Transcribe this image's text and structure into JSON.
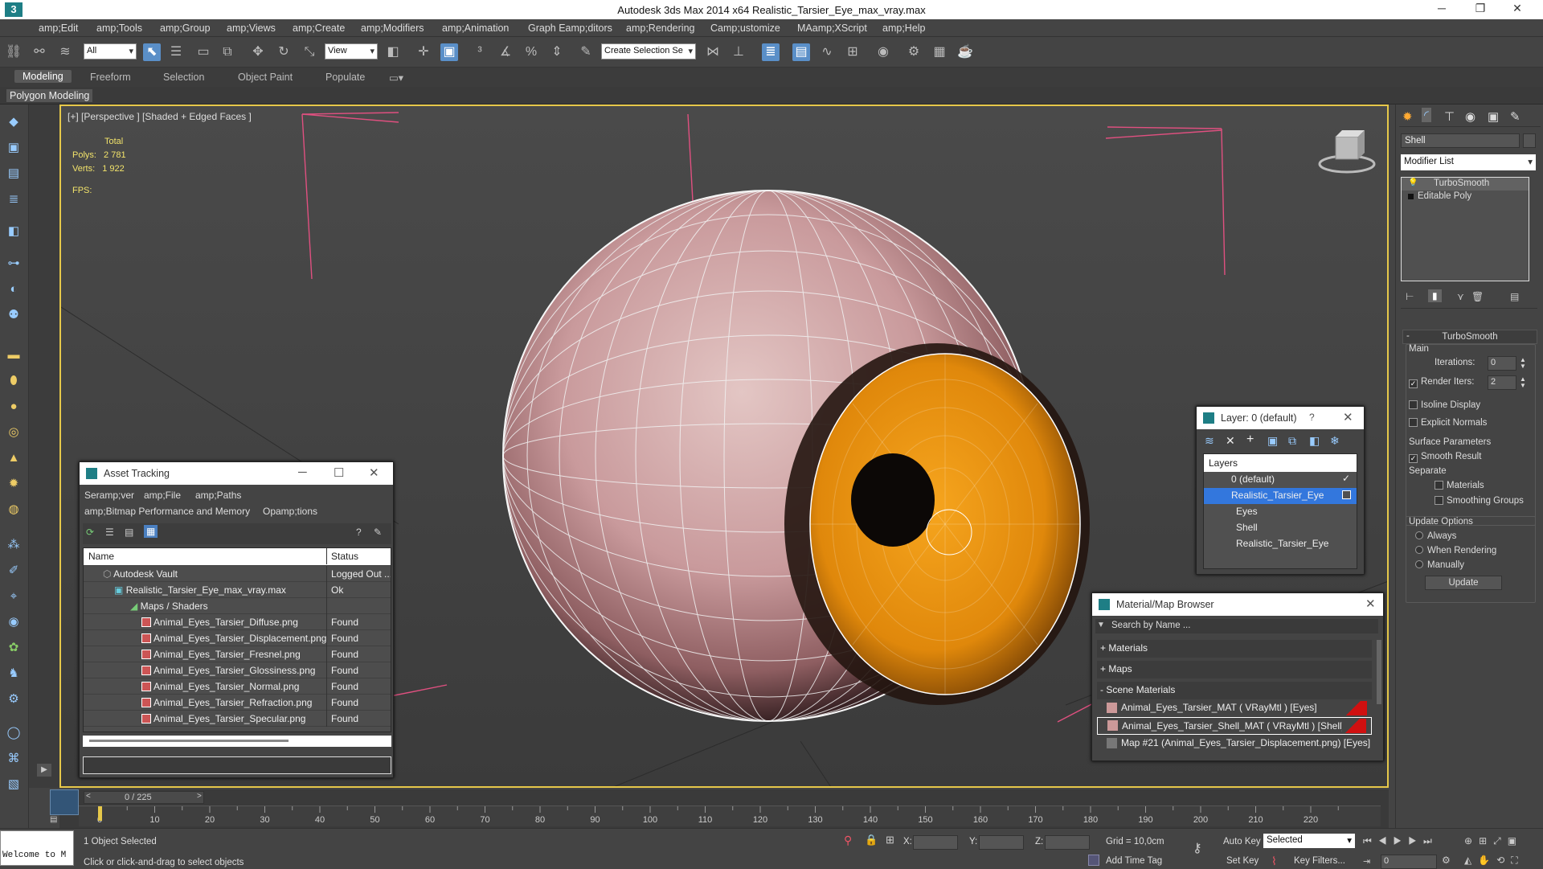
{
  "title": "Autodesk 3ds Max  2014 x64      Realistic_Tarsier_Eye_max_vray.max",
  "menu": [
    "amp;Edit",
    "amp;Tools",
    "amp;Group",
    "amp;Views",
    "amp;Create",
    "amp;Modifiers",
    "amp;Animation",
    "Graph Eamp;ditors",
    "amp;Rendering",
    "Camp;ustomize",
    "MAamp;XScript",
    "amp;Help"
  ],
  "toolbar": {
    "filter": "All",
    "refcoord": "View",
    "selset": "Create Selection Se"
  },
  "ribbon": {
    "tabs": [
      "Modeling",
      "Freeform",
      "Selection",
      "Object Paint",
      "Populate"
    ],
    "sub": "Polygon Modeling"
  },
  "viewport": {
    "label": "[+] [Perspective ] [Shaded + Edged Faces ]",
    "stats": {
      "total": "Total",
      "polys_label": "Polys:",
      "polys": "2 781",
      "verts_label": "Verts:",
      "verts": "1 922",
      "fps": "FPS:"
    }
  },
  "asset": {
    "title": "Asset Tracking",
    "menu": [
      "Seramp;ver",
      "amp;File",
      "amp;Paths",
      "amp;Bitmap Performance and Memory",
      "Opamp;tions"
    ],
    "cols": [
      "Name",
      "Status"
    ],
    "rows": [
      {
        "name": "Autodesk Vault",
        "status": "Logged Out ..."
      },
      {
        "name": "Realistic_Tarsier_Eye_max_vray.max",
        "status": "Ok"
      },
      {
        "name": "Maps / Shaders",
        "status": ""
      },
      {
        "name": "Animal_Eyes_Tarsier_Diffuse.png",
        "status": "Found"
      },
      {
        "name": "Animal_Eyes_Tarsier_Displacement.png",
        "status": "Found"
      },
      {
        "name": "Animal_Eyes_Tarsier_Fresnel.png",
        "status": "Found"
      },
      {
        "name": "Animal_Eyes_Tarsier_Glossiness.png",
        "status": "Found"
      },
      {
        "name": "Animal_Eyes_Tarsier_Normal.png",
        "status": "Found"
      },
      {
        "name": "Animal_Eyes_Tarsier_Refraction.png",
        "status": "Found"
      },
      {
        "name": "Animal_Eyes_Tarsier_Specular.png",
        "status": "Found"
      }
    ]
  },
  "layer": {
    "title": "Layer: 0 (default)",
    "help": "?",
    "header": "Layers",
    "items": [
      "0 (default)",
      "Realistic_Tarsier_Eye",
      "Eyes",
      "Shell",
      "Realistic_Tarsier_Eye"
    ]
  },
  "mat": {
    "title": "Material/Map Browser",
    "search": "Search by Name ...",
    "groups": [
      "+ Materials",
      "+ Maps",
      "- Scene Materials"
    ],
    "items": [
      "Animal_Eyes_Tarsier_MAT  ( VRayMtl ) [Eyes]",
      "Animal_Eyes_Tarsier_Shell_MAT  ( VRayMtl ) [Shell]",
      "Map #21 (Animal_Eyes_Tarsier_Displacement.png) [Eyes]"
    ]
  },
  "cmd": {
    "name": "Shell",
    "modlist": "Modifier List",
    "stack": [
      "TurboSmooth",
      "Editable Poly"
    ],
    "rollout": "TurboSmooth",
    "main": "Main",
    "iter_label": "Iterations:",
    "iter": "0",
    "render_label": "Render Iters:",
    "render": "2",
    "isoline": "Isoline Display",
    "explicit": "Explicit Normals",
    "surface": "Surface Parameters",
    "smooth": "Smooth Result",
    "separate": "Separate",
    "materials": "Materials",
    "smgroups": "Smoothing Groups",
    "update_opts": "Update Options",
    "always": "Always",
    "when_render": "When Rendering",
    "manually": "Manually",
    "update": "Update"
  },
  "timeline": {
    "frame": "0 / 225",
    "ticks": [
      "0",
      "10",
      "20",
      "30",
      "40",
      "50",
      "60",
      "70",
      "80",
      "90",
      "100",
      "110",
      "120",
      "130",
      "140",
      "150",
      "160",
      "170",
      "180",
      "190",
      "200",
      "210",
      "220"
    ]
  },
  "status": {
    "selected": "1 Object Selected",
    "prompt": "Click or click-and-drag to select objects",
    "welcome": "Welcome to M",
    "x": "X:",
    "y": "Y:",
    "z": "Z:",
    "grid": "Grid = 10,0cm",
    "autokey": "Auto Key",
    "setkey": "Set Key",
    "selmode": "Selected",
    "keyfilters": "Key Filters...",
    "addtag": "Add Time Tag",
    "frame": "0"
  }
}
